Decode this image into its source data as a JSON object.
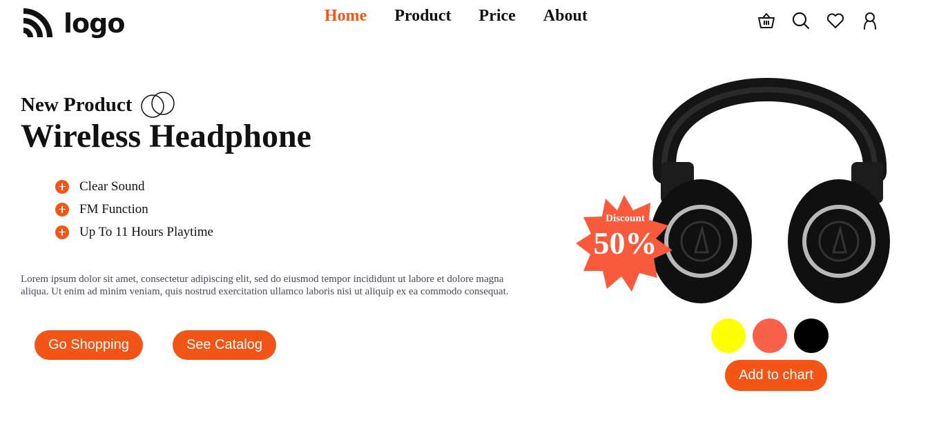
{
  "logo": {
    "text": "logo",
    "icon": "rss-logo-icon"
  },
  "nav": [
    {
      "label": "Home",
      "active": true
    },
    {
      "label": "Product",
      "active": false
    },
    {
      "label": "Price",
      "active": false
    },
    {
      "label": "About",
      "active": false
    }
  ],
  "header_icons": [
    "basket-icon",
    "search-icon",
    "heart-icon",
    "user-icon"
  ],
  "hero": {
    "eyebrow": "New Product",
    "title": "Wireless Headphone",
    "features": [
      "Clear Sound",
      "FM Function",
      "Up To 11 Hours Playtime"
    ],
    "description": "Lorem ipsum dolor sit amet, consectetur adipiscing elit, sed do eiusmod tempor incididunt ut labore et dolore magna aliqua. Ut enim ad minim veniam, quis nostrud exercitation ullamco laboris nisi ut aliquip ex ea commodo consequat.",
    "go_shopping_label": "Go Shopping",
    "see_catalog_label": "See Catalog"
  },
  "product": {
    "discount_label": "Discount",
    "discount_value": "50%",
    "colors": [
      "#ffff00",
      "#fa614a",
      "#000000"
    ],
    "add_label": "Add to chart"
  },
  "colors": {
    "accent": "#f25515",
    "text": "#111111",
    "badge": "#fa5a3c"
  }
}
